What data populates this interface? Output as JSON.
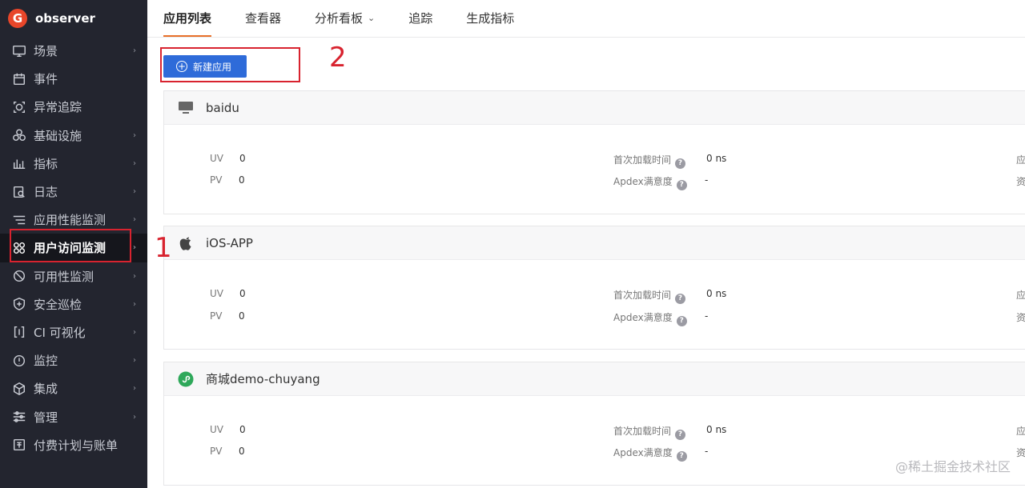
{
  "app": {
    "name": "observer",
    "logo_letter": "G"
  },
  "sidebar": {
    "items": [
      {
        "label": "场景",
        "icon": "monitor-icon",
        "has_arrow": true
      },
      {
        "label": "事件",
        "icon": "calendar-icon",
        "has_arrow": false
      },
      {
        "label": "异常追踪",
        "icon": "target-icon",
        "has_arrow": false
      },
      {
        "label": "基础设施",
        "icon": "cluster-icon",
        "has_arrow": true
      },
      {
        "label": "指标",
        "icon": "bar-chart-icon",
        "has_arrow": true
      },
      {
        "label": "日志",
        "icon": "log-search-icon",
        "has_arrow": true
      },
      {
        "label": "应用性能监测",
        "icon": "list-filter-icon",
        "has_arrow": true
      },
      {
        "label": "用户访问监测",
        "icon": "grid-icon",
        "has_arrow": true,
        "active": true
      },
      {
        "label": "可用性监测",
        "icon": "no-entry-icon",
        "has_arrow": true
      },
      {
        "label": "安全巡检",
        "icon": "shield-icon",
        "has_arrow": true
      },
      {
        "label": "CI 可视化",
        "icon": "ci-icon",
        "has_arrow": true
      },
      {
        "label": "监控",
        "icon": "alert-icon",
        "has_arrow": true
      },
      {
        "label": "集成",
        "icon": "cube-icon",
        "has_arrow": true
      },
      {
        "label": "管理",
        "icon": "sliders-icon",
        "has_arrow": true
      },
      {
        "label": "付费计划与账单",
        "icon": "bill-icon",
        "has_arrow": false
      }
    ]
  },
  "tabs": [
    {
      "label": "应用列表",
      "active": true
    },
    {
      "label": "查看器"
    },
    {
      "label": "分析看板",
      "dropdown": true
    },
    {
      "label": "追踪"
    },
    {
      "label": "生成指标"
    }
  ],
  "toolbar": {
    "new_app_label": "新建应用"
  },
  "annotations": {
    "num1": "1",
    "num2": "2"
  },
  "labels": {
    "uv": "UV",
    "pv": "PV",
    "first_load": "首次加载时间",
    "apdex": "Apdex满意度",
    "cut1": "应",
    "cut2": "资"
  },
  "apps": [
    {
      "name": "baidu",
      "icon": "desktop-icon",
      "uv": "0",
      "pv": "0",
      "first_load": "0 ns",
      "apdex": "-"
    },
    {
      "name": "iOS-APP",
      "icon": "apple-icon",
      "uv": "0",
      "pv": "0",
      "first_load": "0 ns",
      "apdex": "-"
    },
    {
      "name": "商城demo-chuyang",
      "icon": "miniprogram-icon",
      "uv": "0",
      "pv": "0",
      "first_load": "0 ns",
      "apdex": "-"
    }
  ],
  "watermark": "@稀土掘金技术社区",
  "colors": {
    "sidebar_bg": "#23252f",
    "primary": "#2e6bd9",
    "accent": "#e8702a",
    "annotation": "#d8232f"
  }
}
